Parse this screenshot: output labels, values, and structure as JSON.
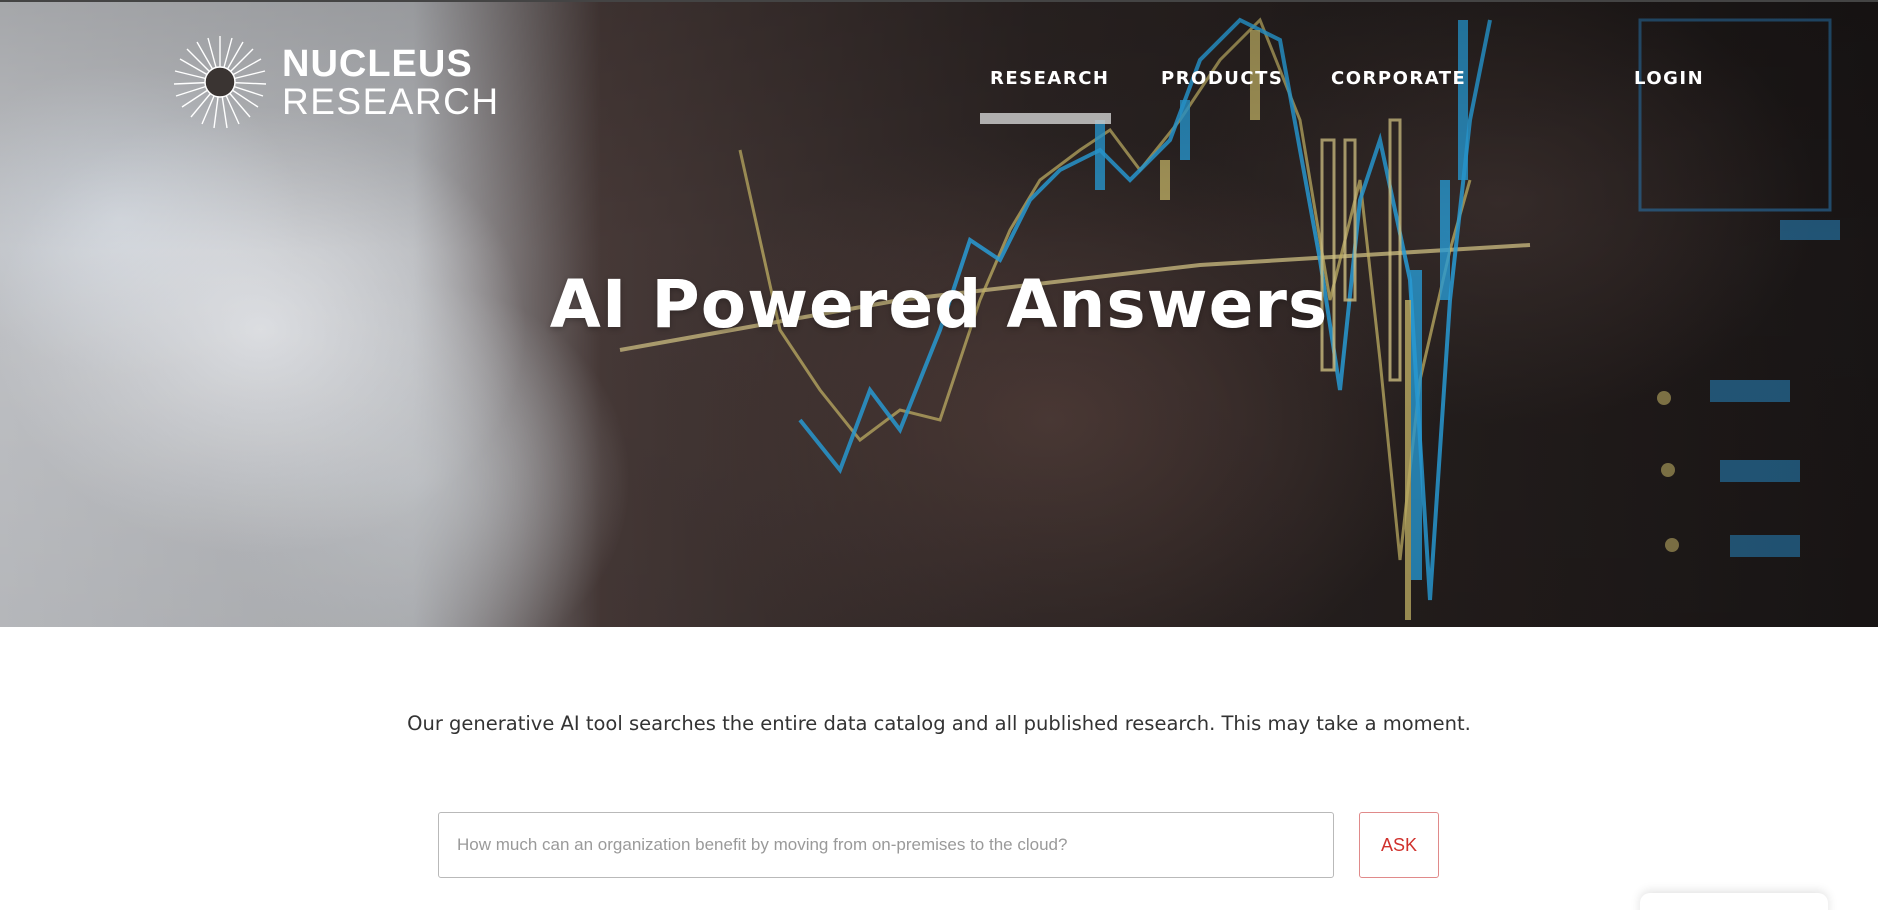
{
  "header": {
    "logo_line1": "NUCLEUS",
    "logo_line2": "RESEARCH",
    "nav": {
      "research": "RESEARCH",
      "products": "PRODUCTS",
      "corporate": "CORPORATE",
      "login": "LOGIN"
    },
    "active_tab": "RESEARCH"
  },
  "hero": {
    "title": "AI Powered Answers",
    "background_icon": "stock-chart-background"
  },
  "main": {
    "intro_text": "Our generative AI tool searches the entire data catalog and all published research. This may take a moment.",
    "search": {
      "placeholder": "How much can an organization benefit by moving from on-premises to the cloud?",
      "value": ""
    },
    "ask_label": "ASK"
  },
  "colors": {
    "accent_red": "#d0312d",
    "nav_text": "#ffffff",
    "body_text": "#333333"
  }
}
